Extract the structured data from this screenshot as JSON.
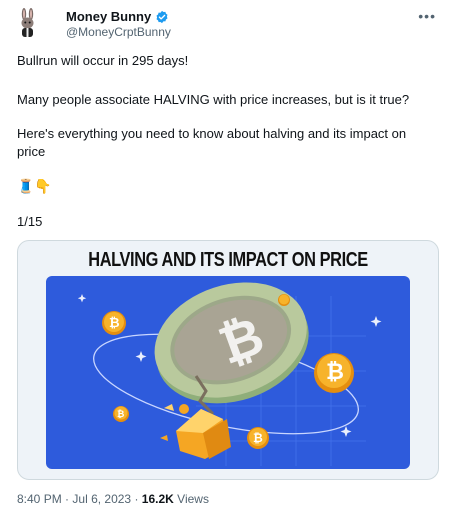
{
  "author": {
    "name": "Money Bunny",
    "handle": "@MoneyCrptBunny"
  },
  "tweet": {
    "line1": "Bullrun will occur in 295 days!",
    "line2": "Many people associate HALVING with price increases, but is it true?",
    "line3": "Here's everything you need to know about halving and its impact on price",
    "emojis": "🧵👇",
    "counter": "1/15"
  },
  "media": {
    "title": "HALVING AND ITS IMPACT ON PRICE"
  },
  "meta": {
    "time": "8:40 PM",
    "date": "Jul 6, 2023",
    "views_count": "16.2K",
    "views_label": "Views"
  },
  "colors": {
    "accent_blue": "#1d9bf0",
    "illustration_bg": "#2e5bdc",
    "coin_orange": "#f5a623"
  }
}
